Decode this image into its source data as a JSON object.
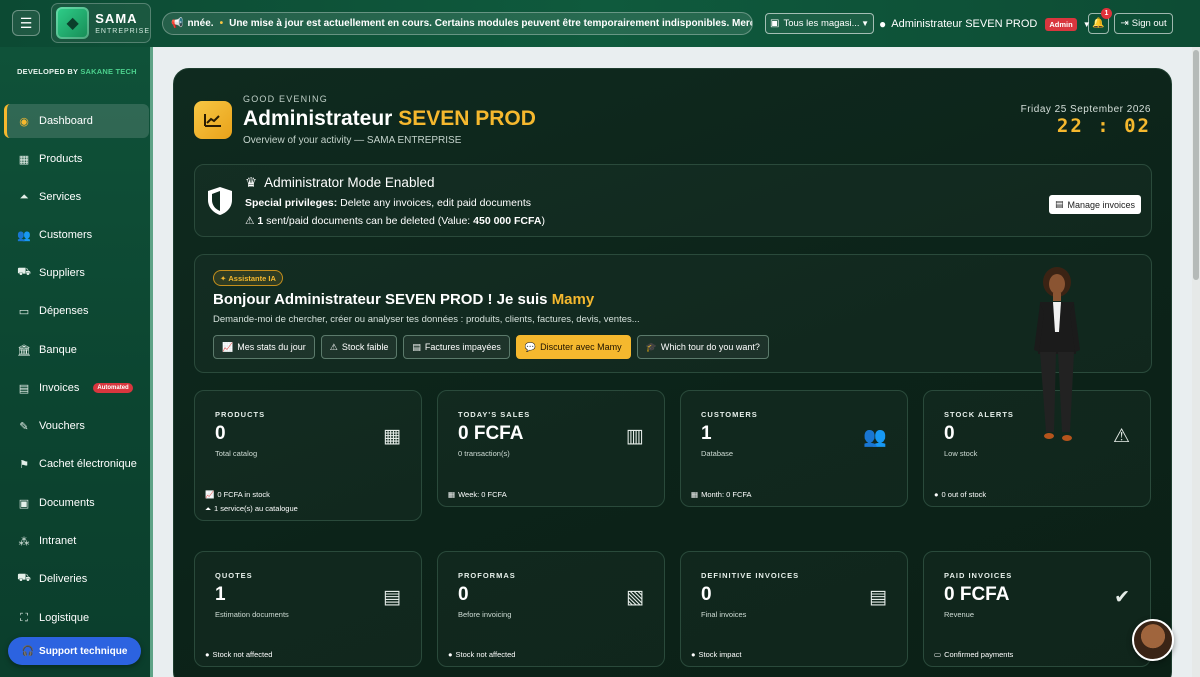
{
  "topbar": {
    "logo_title": "SAMA",
    "logo_subtitle": "ENTREPRISE",
    "ticker_prefix": "nnée.",
    "ticker_text": "Une mise à jour est actuellement en cours. Certains modules peuvent être temporairement indisponibles. Merci",
    "store_select": "Tous les magasi...",
    "user_name": "Administrateur SEVEN PROD",
    "user_role_badge": "Admin",
    "notification_count": "1",
    "signout_label": "Sign out"
  },
  "sidebar": {
    "developed_by": "DEVELOPED BY",
    "developer": "SAKANE TECH",
    "items": [
      {
        "label": "Dashboard",
        "icon": "palette-icon",
        "active": true
      },
      {
        "label": "Products",
        "icon": "box-icon"
      },
      {
        "label": "Services",
        "icon": "concierge-icon"
      },
      {
        "label": "Customers",
        "icon": "users-icon"
      },
      {
        "label": "Suppliers",
        "icon": "truck-icon"
      },
      {
        "label": "Dépenses",
        "icon": "money-icon"
      },
      {
        "label": "Banque",
        "icon": "bank-icon"
      },
      {
        "label": "Invoices",
        "icon": "invoice-icon",
        "badge": "Automated"
      },
      {
        "label": "Vouchers",
        "icon": "voucher-icon"
      },
      {
        "label": "Cachet électronique",
        "icon": "stamp-icon"
      },
      {
        "label": "Documents",
        "icon": "folder-icon"
      },
      {
        "label": "Intranet",
        "icon": "network-icon"
      },
      {
        "label": "Deliveries",
        "icon": "delivery-icon"
      },
      {
        "label": "Logistique",
        "icon": "logistics-icon"
      }
    ],
    "support_label": "Support technique"
  },
  "header": {
    "greeting": "GOOD EVENING",
    "title_prefix": "Administrateur",
    "title_accent": "SEVEN PROD",
    "overview": "Overview of your activity — SAMA ENTREPRISE",
    "date": "Friday 25 September 2026",
    "time": "22 : 02"
  },
  "admin_mode": {
    "title": "Administrator Mode Enabled",
    "privileges_label": "Special privileges:",
    "privileges_text": "Delete any invoices, edit paid documents",
    "deletable_count": "1",
    "deletable_text": "sent/paid documents can be deleted (Value:",
    "deletable_value": "450 000 FCFA",
    "deletable_close": ")",
    "manage_button": "Manage invoices"
  },
  "assistant": {
    "badge": "Assistante IA",
    "title_prefix": "Bonjour Administrateur SEVEN PROD ! Je suis",
    "title_name": "Mamy",
    "subtitle": "Demande-moi de chercher, créer ou analyser tes données : produits, clients, factures, devis, ventes...",
    "buttons": [
      {
        "label": "Mes stats du jour",
        "icon": "chart-line-icon"
      },
      {
        "label": "Stock faible",
        "icon": "warning-icon"
      },
      {
        "label": "Factures impayées",
        "icon": "invoice-icon"
      },
      {
        "label": "Discuter avec Mamy",
        "icon": "chat-icon",
        "primary": true
      },
      {
        "label": "Which tour do you want?",
        "icon": "graduation-cap-icon"
      }
    ]
  },
  "stats": [
    {
      "label": "PRODUCTS",
      "value": "0",
      "sub": "Total catalog",
      "icon": "box-icon",
      "footer": [
        "0 FCFA in stock",
        "1 service(s) au catalogue"
      ]
    },
    {
      "label": "TODAY'S SALES",
      "value": "0 FCFA",
      "sub": "0 transaction(s)",
      "icon": "cash-register-icon",
      "footer": [
        "Week: 0 FCFA"
      ]
    },
    {
      "label": "CUSTOMERS",
      "value": "1",
      "sub": "Database",
      "icon": "users-icon",
      "footer": [
        "Month: 0 FCFA"
      ]
    },
    {
      "label": "STOCK ALERTS",
      "value": "0",
      "sub": "Low stock",
      "icon": "warning-icon",
      "footer": [
        "0 out of stock"
      ]
    }
  ],
  "documents": [
    {
      "label": "QUOTES",
      "value": "1",
      "sub": "Estimation documents",
      "icon": "document-icon",
      "footer": "Stock not affected"
    },
    {
      "label": "PROFORMAS",
      "value": "0",
      "sub": "Before invoicing",
      "icon": "file-invoice-icon",
      "footer": "Stock not affected"
    },
    {
      "label": "DEFINITIVE INVOICES",
      "value": "0",
      "sub": "Final invoices",
      "icon": "file-lines-icon",
      "footer": "Stock impact"
    },
    {
      "label": "PAID INVOICES",
      "value": "0 FCFA",
      "sub": "Revenue",
      "icon": "check-circle-icon",
      "footer": "Confirmed payments"
    }
  ]
}
